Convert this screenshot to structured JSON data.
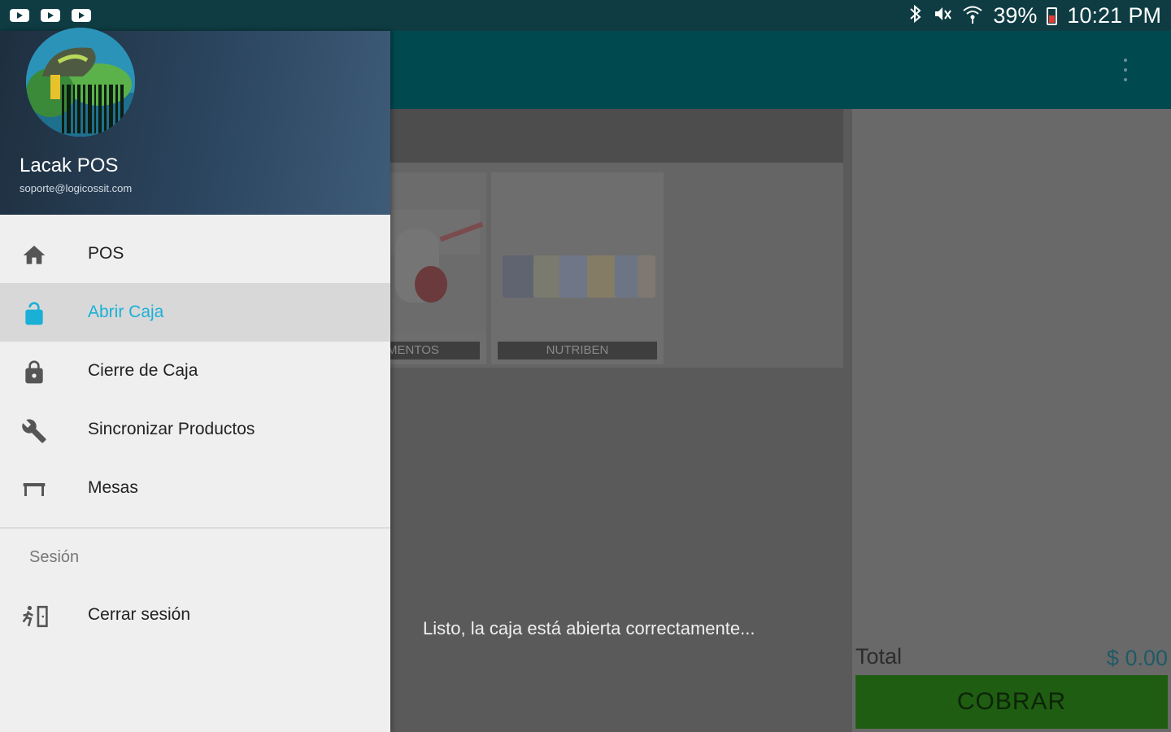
{
  "status_bar": {
    "battery": "39%",
    "time": "10:21 PM",
    "icons": [
      "youtube-notification-icon",
      "youtube-notification-icon",
      "youtube-notification-icon",
      "bluetooth-icon",
      "mute-icon",
      "wifi-icon",
      "battery-icon"
    ]
  },
  "drawer": {
    "app_name": "Lacak POS",
    "email": "soporte@logicossit.com",
    "menu": [
      {
        "label": "POS",
        "icon": "home-icon"
      },
      {
        "label": "Abrir Caja",
        "icon": "lock-open-icon",
        "active": true
      },
      {
        "label": "Cierre de Caja",
        "icon": "lock-icon"
      },
      {
        "label": "Sincronizar Productos",
        "icon": "wrench-icon"
      },
      {
        "label": "Mesas",
        "icon": "table-icon"
      }
    ],
    "section_title": "Sesión",
    "logout": {
      "label": "Cerrar sesión",
      "icon": "exit-icon"
    }
  },
  "products": [
    {
      "label": "MENTOS"
    },
    {
      "label": "NUTRIBEN"
    }
  ],
  "cart": {
    "total_label": "Total",
    "total_value": "$ 0.00",
    "charge_label": "COBRAR"
  },
  "toast": "Listo, la caja está abierta correctamente...",
  "colors": {
    "status_bar": "#0e3c42",
    "accent": "#1ab0d6",
    "charge_button": "#1f5d12"
  }
}
